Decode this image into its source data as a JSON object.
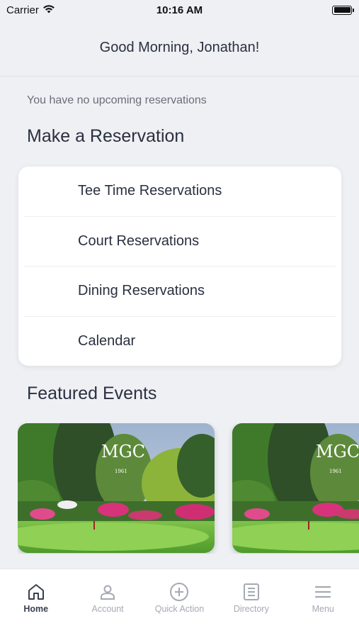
{
  "status_bar": {
    "carrier": "Carrier",
    "time": "10:16 AM"
  },
  "header": {
    "greeting": "Good Morning, Jonathan!"
  },
  "reservations": {
    "note": "You have no upcoming reservations"
  },
  "make_reservation": {
    "title": "Make a Reservation",
    "items": [
      {
        "label": "Tee Time Reservations"
      },
      {
        "label": "Court Reservations"
      },
      {
        "label": "Dining Reservations"
      },
      {
        "label": "Calendar"
      }
    ]
  },
  "featured_events": {
    "title": "Featured Events",
    "cards": [
      {
        "logo_letters": "MGC",
        "logo_year": "1961"
      },
      {
        "logo_letters": "MGC",
        "logo_year": "1961"
      }
    ]
  },
  "tab_bar": {
    "tabs": [
      {
        "label": "Home",
        "icon": "home-icon",
        "active": true
      },
      {
        "label": "Account",
        "icon": "person-icon",
        "active": false
      },
      {
        "label": "Quick Action",
        "icon": "plus-circle-icon",
        "active": false
      },
      {
        "label": "Directory",
        "icon": "directory-icon",
        "active": false
      },
      {
        "label": "Menu",
        "icon": "hamburger-icon",
        "active": false
      }
    ]
  },
  "colors": {
    "background": "#eef0f4",
    "text": "#2b3040",
    "tab_inactive": "#a5a9b2"
  }
}
